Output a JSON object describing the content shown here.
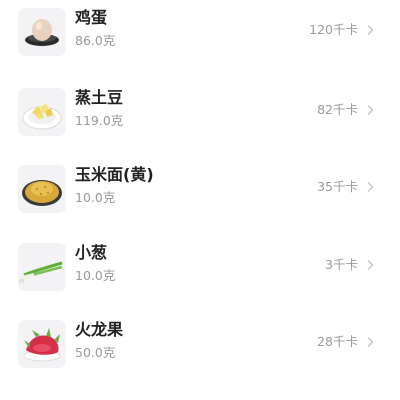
{
  "foods": [
    {
      "name": "鸡蛋",
      "weight": "86.0克",
      "calories": "120千卡",
      "icon": "egg-icon"
    },
    {
      "name": "蒸土豆",
      "weight": "119.0克",
      "calories": "82千卡",
      "icon": "potato-icon"
    },
    {
      "name": "玉米面(黄)",
      "weight": "10.0克",
      "calories": "35千卡",
      "icon": "cornmeal-icon"
    },
    {
      "name": "小葱",
      "weight": "10.0克",
      "calories": "3千卡",
      "icon": "scallion-icon"
    },
    {
      "name": "火龙果",
      "weight": "50.0克",
      "calories": "28千卡",
      "icon": "dragonfruit-icon"
    }
  ],
  "colors": {
    "name_text": "#222222",
    "secondary_text": "#9a9a9a",
    "thumb_bg": "#f3f3f5",
    "chevron": "#c8c8c8"
  }
}
